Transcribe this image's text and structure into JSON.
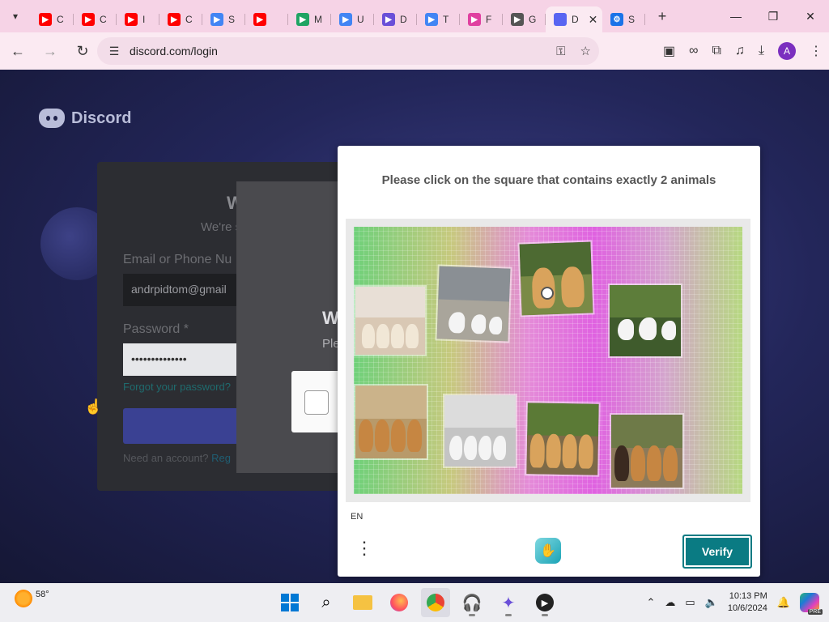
{
  "browser": {
    "tabs": [
      {
        "label": "C",
        "icon": "youtube-icon",
        "color": "#ff0000"
      },
      {
        "label": "C",
        "icon": "youtube-icon",
        "color": "#ff0000"
      },
      {
        "label": "I",
        "icon": "youtube-icon",
        "color": "#ff0000"
      },
      {
        "label": "C",
        "icon": "youtube-icon",
        "color": "#ff0000"
      },
      {
        "label": "S",
        "icon": "google-icon",
        "color": "#4285f4"
      },
      {
        "label": "",
        "icon": "youtube-audio-icon",
        "color": "#ff0000"
      },
      {
        "label": "M",
        "icon": "google-drive-icon",
        "color": "#1fa463"
      },
      {
        "label": "U",
        "icon": "google-docs-icon",
        "color": "#4285f4"
      },
      {
        "label": "D",
        "icon": "dancer-icon",
        "color": "#6a4fd8"
      },
      {
        "label": "T",
        "icon": "google-icon",
        "color": "#4285f4"
      },
      {
        "label": "F",
        "icon": "colorful-app-icon",
        "color": "#e040a0"
      },
      {
        "label": "G",
        "icon": "key-icon",
        "color": "#555555"
      }
    ],
    "active_tab": {
      "label": "D",
      "close": "✕"
    },
    "settings_tab": {
      "label": "S",
      "icon": "gear-icon",
      "color": "#1a73e8"
    },
    "new_tab": "+",
    "url": "discord.com/login"
  },
  "discord": {
    "brand": "Discord",
    "login": {
      "title": "W",
      "subtitle": "We're s",
      "email_label": "Email or Phone Nu",
      "email_value": "andrpidtom@gmail",
      "password_label": "Password *",
      "password_value": "••••••••••••••",
      "forgot_link": "Forgot your password?",
      "footer_text": "Need an account?",
      "footer_link": "Reg"
    },
    "overlay": {
      "title": "W",
      "subtitle": "Ple"
    }
  },
  "captcha": {
    "prompt": "Please click on the square that contains exactly 2 animals",
    "language": "EN",
    "verify_label": "Verify",
    "accent": "#0a7b83"
  },
  "taskbar": {
    "weather": "58°",
    "time": "10:13 PM",
    "date": "10/6/2024",
    "copilot_badge": "PRE"
  }
}
